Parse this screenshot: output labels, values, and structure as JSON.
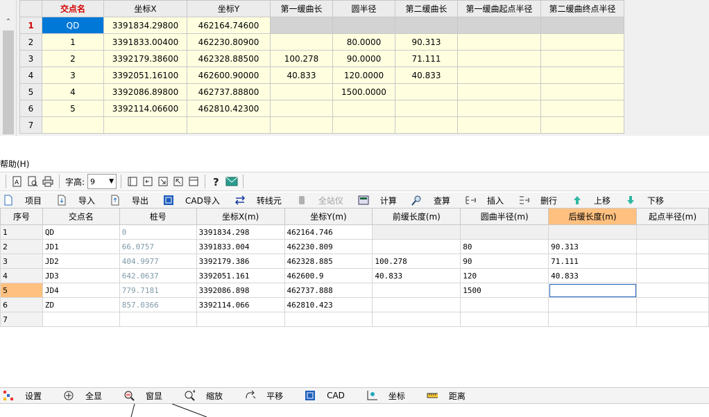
{
  "top_grid": {
    "headers": [
      "交点名",
      "坐标X",
      "坐标Y",
      "第一缓曲长",
      "圆半径",
      "第二缓曲长",
      "第一缓曲起点半径",
      "第二缓曲终点半径"
    ],
    "rows": [
      {
        "num": "1",
        "cells": [
          "QD",
          "3391834.29800",
          "462164.74600",
          "",
          "",
          "",
          "",
          ""
        ]
      },
      {
        "num": "2",
        "cells": [
          "1",
          "3391833.00400",
          "462230.80900",
          "",
          "80.0000",
          "90.313",
          "",
          ""
        ]
      },
      {
        "num": "3",
        "cells": [
          "2",
          "3392179.38600",
          "462328.88500",
          "100.278",
          "90.0000",
          "71.111",
          "",
          ""
        ]
      },
      {
        "num": "4",
        "cells": [
          "3",
          "3392051.16100",
          "462600.90000",
          "40.833",
          "120.0000",
          "40.833",
          "",
          ""
        ]
      },
      {
        "num": "5",
        "cells": [
          "4",
          "3392086.89800",
          "462737.88800",
          "",
          "1500.0000",
          "",
          "",
          ""
        ]
      },
      {
        "num": "6",
        "cells": [
          "5",
          "3392114.06600",
          "462810.42300",
          "",
          "",
          "",
          "",
          ""
        ]
      },
      {
        "num": "7",
        "cells": [
          "",
          "",
          "",
          "",
          "",
          "",
          "",
          ""
        ]
      }
    ]
  },
  "menu": {
    "help": "帮助(H)"
  },
  "toolbar1": {
    "font_label": "字高:",
    "font_value": "9"
  },
  "toolbar2": [
    {
      "label": "项目",
      "icon": "new-doc-icon",
      "enabled": true
    },
    {
      "label": "导入",
      "icon": "import-icon",
      "enabled": true
    },
    {
      "label": "导出",
      "icon": "export-icon",
      "enabled": true
    },
    {
      "label": "CAD导入",
      "icon": "cad-import-icon",
      "enabled": true
    },
    {
      "label": "转线元",
      "icon": "swap-icon",
      "enabled": true
    },
    {
      "label": "全站仪",
      "icon": "total-station-icon",
      "enabled": false
    },
    {
      "label": "计算",
      "icon": "calculator-icon",
      "enabled": true
    },
    {
      "label": "查算",
      "icon": "magnifier-icon",
      "enabled": true
    },
    {
      "label": "插入",
      "icon": "insert-row-icon",
      "enabled": true
    },
    {
      "label": "删行",
      "icon": "delete-row-icon",
      "enabled": true
    },
    {
      "label": "上移",
      "icon": "arrow-up-icon",
      "enabled": true
    },
    {
      "label": "下移",
      "icon": "arrow-down-icon",
      "enabled": true
    }
  ],
  "bottom_grid": {
    "headers": [
      "序号",
      "交点名",
      "桩号",
      "坐标X(m)",
      "坐标Y(m)",
      "前缓长度(m)",
      "圆曲半径(m)",
      "后缓长度(m)",
      "起点半径(m)"
    ],
    "rows": [
      {
        "num": "1",
        "cells": [
          "QD",
          "0",
          "3391834.298",
          "462164.746",
          "",
          "",
          "",
          ""
        ]
      },
      {
        "num": "2",
        "cells": [
          "JD1",
          "66.0757",
          "3391833.004",
          "462230.809",
          "",
          "80",
          "90.313",
          ""
        ]
      },
      {
        "num": "3",
        "cells": [
          "JD2",
          "404.9977",
          "3392179.386",
          "462328.885",
          "100.278",
          "90",
          "71.111",
          ""
        ]
      },
      {
        "num": "4",
        "cells": [
          "JD3",
          "642.0637",
          "3392051.161",
          "462600.9",
          "40.833",
          "120",
          "40.833",
          ""
        ]
      },
      {
        "num": "5",
        "cells": [
          "JD4",
          "779.7181",
          "3392086.898",
          "462737.888",
          "",
          "1500",
          "",
          ""
        ]
      },
      {
        "num": "6",
        "cells": [
          "ZD",
          "857.0366",
          "3392114.066",
          "462810.423",
          "",
          "",
          "",
          ""
        ]
      },
      {
        "num": "7",
        "cells": [
          "",
          "",
          "",
          "",
          "",
          "",
          "",
          ""
        ]
      }
    ]
  },
  "toolbar3": [
    {
      "label": "设置",
      "icon": "settings-palette-icon"
    },
    {
      "label": "全显",
      "icon": "zoom-extents-icon"
    },
    {
      "label": "窗显",
      "icon": "zoom-window-icon"
    },
    {
      "label": "缩放",
      "icon": "zoom-icon"
    },
    {
      "label": "平移",
      "icon": "pan-icon"
    },
    {
      "label": "CAD",
      "icon": "cad-icon"
    },
    {
      "label": "坐标",
      "icon": "coordinate-icon"
    },
    {
      "label": "距离",
      "icon": "ruler-icon"
    }
  ]
}
